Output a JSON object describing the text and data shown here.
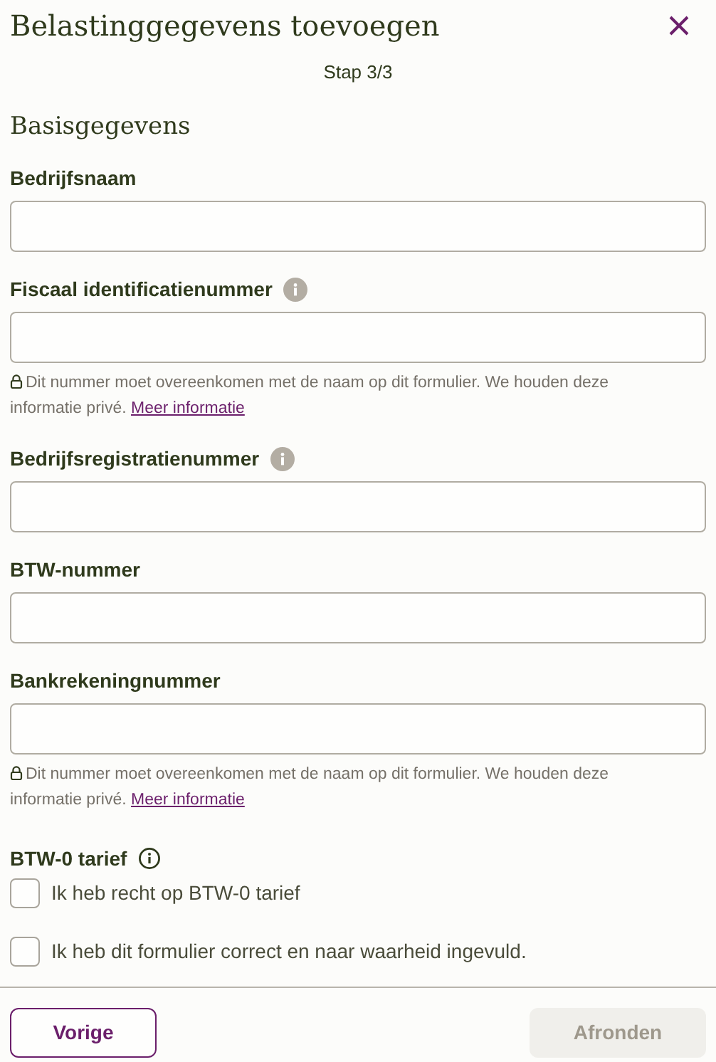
{
  "dialog": {
    "title": "Belastinggegevens toevoegen",
    "step": "Stap 3/3"
  },
  "section": {
    "title": "Basisgegevens"
  },
  "fields": [
    {
      "label": "Bedrijfsnaam",
      "has_info": false
    },
    {
      "label": "Fiscaal identificatienummer",
      "has_info": true,
      "note": {
        "text": "Dit nummer moet overeenkomen met de naam op dit formulier. We houden deze informatie privé.",
        "link": "Meer informatie"
      }
    },
    {
      "label": "Bedrijfsregistratienummer",
      "has_info": true
    },
    {
      "label": "BTW-nummer",
      "has_info": false
    },
    {
      "label": "Bankrekeningnummer",
      "has_info": false,
      "note": {
        "text": "Dit nummer moet overeenkomen met de naam op dit formulier. We houden deze informatie privé.",
        "link": "Meer informatie"
      }
    }
  ],
  "rate": {
    "label": "BTW-0 tarief",
    "has_info": true
  },
  "checkboxes": [
    {
      "label": "Ik heb recht op BTW-0 tarief",
      "checked": false
    },
    {
      "label": "Ik heb dit formulier correct en naar waarheid ingevuld.",
      "checked": false
    }
  ],
  "buttons": [
    {
      "label": "Vorige",
      "kind": "secondary",
      "disabled": false
    },
    {
      "label": "Afronden",
      "kind": "primary",
      "disabled": true
    }
  ]
}
